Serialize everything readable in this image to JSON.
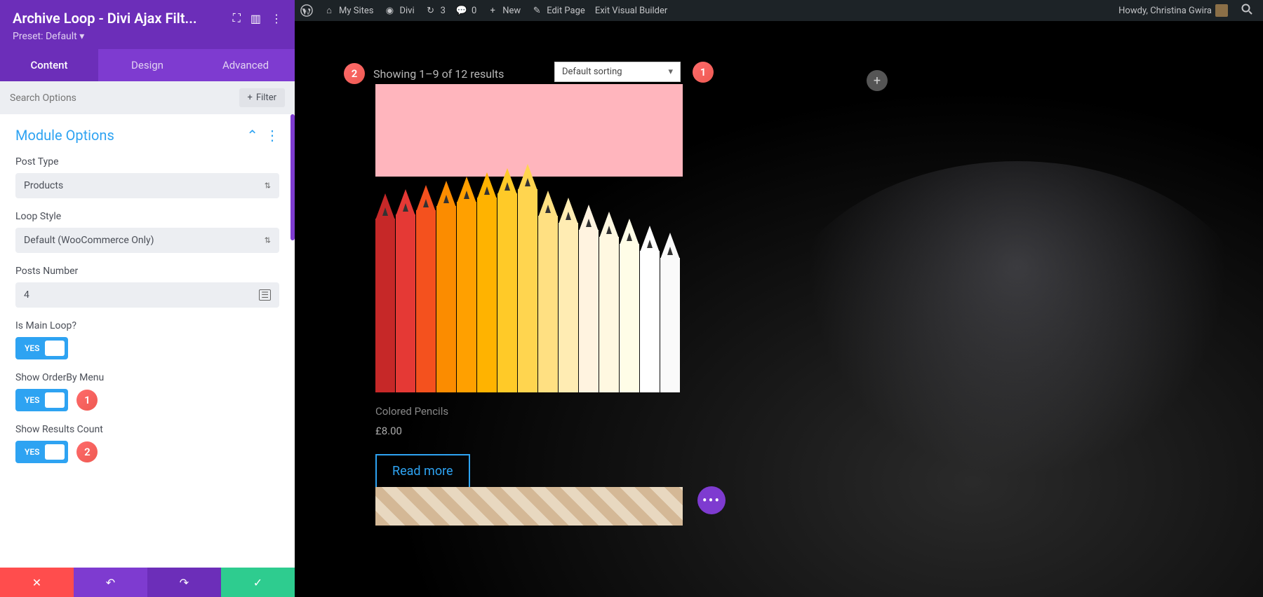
{
  "wp_bar": {
    "my_sites": "My Sites",
    "site_name": "Divi",
    "updates_count": "3",
    "comments_count": "0",
    "new": "New",
    "edit_page": "Edit Page",
    "exit_builder": "Exit Visual Builder",
    "howdy": "Howdy, Christina Gwira"
  },
  "sidebar": {
    "title": "Archive Loop - Divi Ajax Filt...",
    "preset": "Preset: Default ▾",
    "tabs": {
      "content": "Content",
      "design": "Design",
      "advanced": "Advanced"
    },
    "search_placeholder": "Search Options",
    "filter_btn": "Filter",
    "section_title": "Module Options",
    "fields": {
      "post_type_label": "Post Type",
      "post_type_value": "Products",
      "loop_style_label": "Loop Style",
      "loop_style_value": "Default (WooCommerce Only)",
      "posts_number_label": "Posts Number",
      "posts_number_value": "4",
      "is_main_loop_label": "Is Main Loop?",
      "show_orderby_label": "Show OrderBy Menu",
      "show_results_label": "Show Results Count",
      "yes": "YES"
    },
    "badges": {
      "b1": "1",
      "b2": "2"
    }
  },
  "preview": {
    "results_text": "Showing 1–9 of 12 results",
    "sort_value": "Default sorting",
    "product_title": "Colored Pencils",
    "product_price": "£8.00",
    "read_more": "Read more",
    "badges": {
      "b1": "1",
      "b2": "2"
    }
  }
}
